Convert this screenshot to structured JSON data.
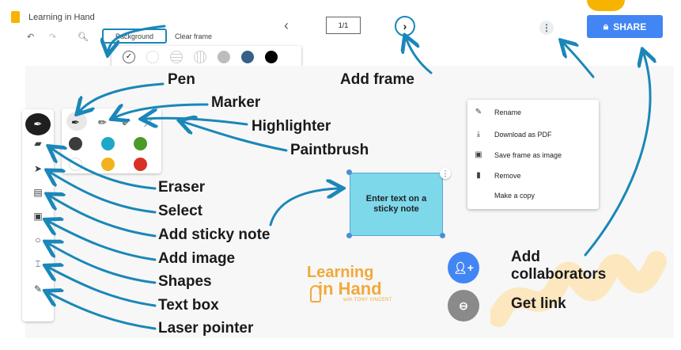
{
  "app": {
    "title": "Learning in Hand",
    "background_label": "Background",
    "clear_frame_label": "Clear frame",
    "frame_counter": "1/1",
    "share_label": "SHARE",
    "accent": "#1a87b8",
    "share_color": "#4285f4"
  },
  "background_palette": [
    "check",
    "grid-dots",
    "lines",
    "grid",
    "gray",
    "#35608a",
    "#000000"
  ],
  "pen_colors": [
    "#3c3c3c",
    "#1fa7c7",
    "#4c9a2a",
    "#ffffff",
    "#f2b21b",
    "#d93025"
  ],
  "menu": {
    "items": [
      {
        "icon": "pencil-icon",
        "label": "Rename"
      },
      {
        "icon": "download-icon",
        "label": "Download as PDF"
      },
      {
        "icon": "image-icon",
        "label": "Save frame as image"
      },
      {
        "icon": "trash-icon",
        "label": "Remove"
      },
      {
        "icon": "",
        "label": "Make a copy"
      }
    ]
  },
  "sticky_note": {
    "text": "Enter text on a sticky note",
    "color": "#7dd8ea"
  },
  "annotations": {
    "pen": "Pen",
    "marker": "Marker",
    "highlighter": "Highlighter",
    "paintbrush": "Paintbrush",
    "add_frame": "Add frame",
    "eraser": "Eraser",
    "select": "Select",
    "add_sticky_note": "Add sticky note",
    "add_image": "Add image",
    "shapes": "Shapes",
    "text_box": "Text box",
    "laser_pointer": "Laser pointer",
    "add_collaborators_1": "Add",
    "add_collaborators_2": "collaborators",
    "get_link": "Get link"
  },
  "logo": {
    "line1": "Learning",
    "line2": "in Hand",
    "byline": "with TONY VINCENT",
    "color": "#f1a93a"
  },
  "arrow_color": "#1a87b8",
  "collab_color": "#4285f4",
  "link_color": "#8a8a8a"
}
